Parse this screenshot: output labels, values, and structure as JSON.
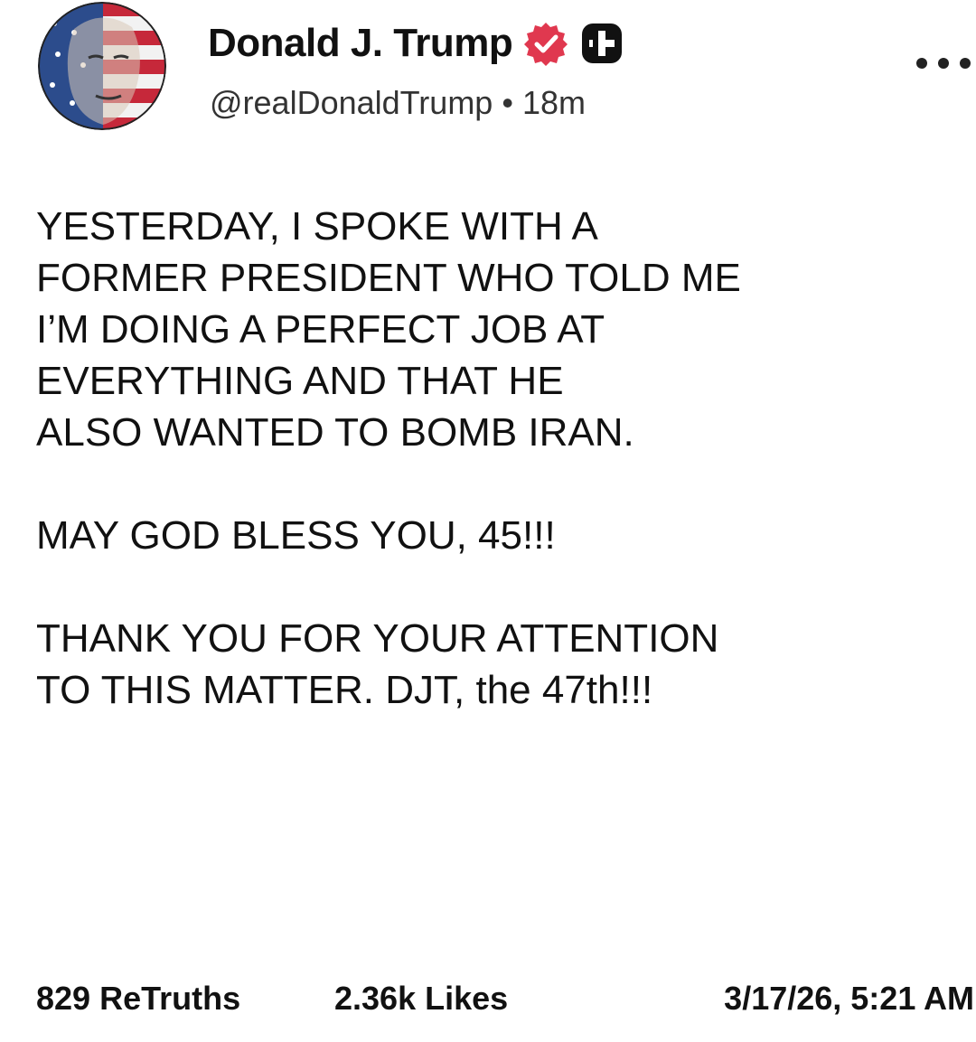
{
  "post": {
    "author": {
      "display_name": "Donald J. Trump",
      "handle": "@realDonaldTrump",
      "separator": "•",
      "time_ago": "18m",
      "avatar_icon": "flag-portrait-avatar",
      "verified_icon": "verified-badge-icon",
      "plus_icon": "truth-plus-icon"
    },
    "more_icon": "more-dots-icon",
    "paragraphs": [
      "YESTERDAY, I SPOKE WITH A\nFORMER PRESIDENT WHO TOLD ME\nI’M DOING A PERFECT JOB AT\nEVERYTHING AND THAT HE\nALSO WANTED TO BOMB IRAN.",
      "MAY GOD BLESS YOU, 45!!!",
      "THANK YOU FOR YOUR ATTENTION\nTO THIS MATTER. DJT, the 47th!!!"
    ],
    "stats": {
      "retruths": "829 ReTruths",
      "likes": "2.36k Likes",
      "timestamp": "3/17/26, 5:21 AM"
    },
    "colors": {
      "verified_red": "#e0384f",
      "text": "#111111"
    }
  }
}
